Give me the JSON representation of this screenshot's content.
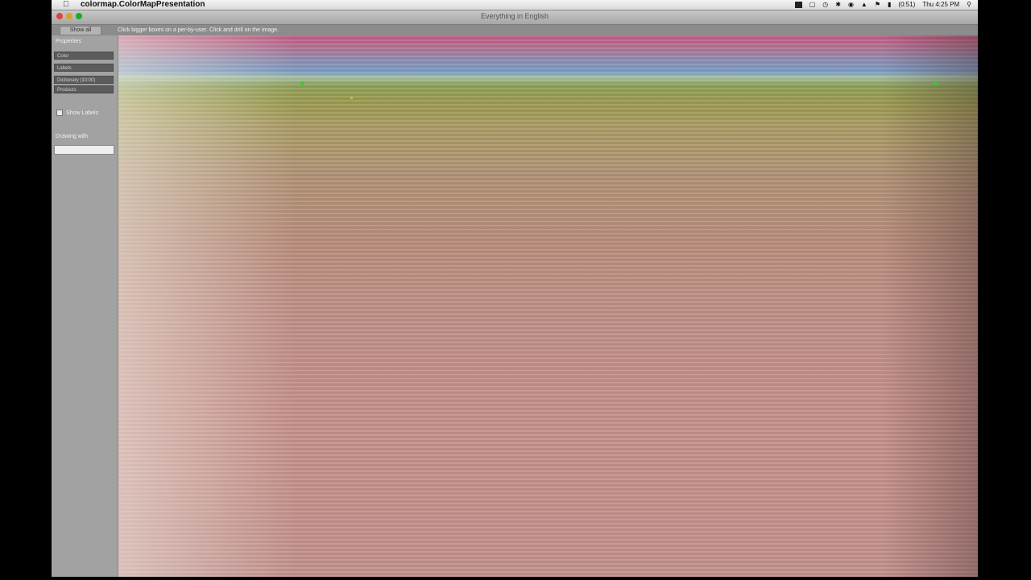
{
  "menubar": {
    "app_name": "colormap.ColorMapPresentation",
    "clock": "Thu 4:25 PM",
    "battery": "(0:51)"
  },
  "window": {
    "title": "Everything in English"
  },
  "toolbar": {
    "show_all_label": "Show all",
    "instructions": "Click bigger boxes on a per-by-user. Click and drill on the image."
  },
  "sidebar": {
    "heading": "Properties",
    "fields": [
      "Color",
      "Labels",
      "Dictionary (10:00)",
      "Products"
    ],
    "checkbox_label": "Show Labels",
    "search_label": "Drawing with"
  },
  "colors": {
    "menubar": "#e8e8e8",
    "sidebar": "#a2a2a2",
    "marker": "#33cc33"
  }
}
